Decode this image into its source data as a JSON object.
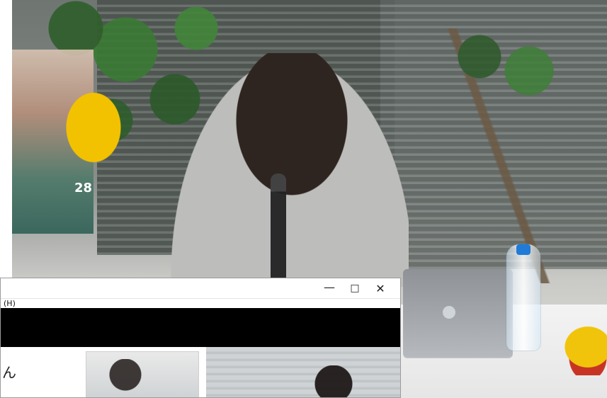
{
  "image": {
    "background_scene": "photo"
  },
  "overlay_window": {
    "menu_fragment": "(H)",
    "window_controls": {
      "minimize_glyph": "—",
      "maximize_glyph": "□",
      "close_glyph": "✕"
    },
    "content_glyph": "ん"
  },
  "colors": {
    "window_border": "#9b9b9b",
    "black_band": "#000000"
  }
}
